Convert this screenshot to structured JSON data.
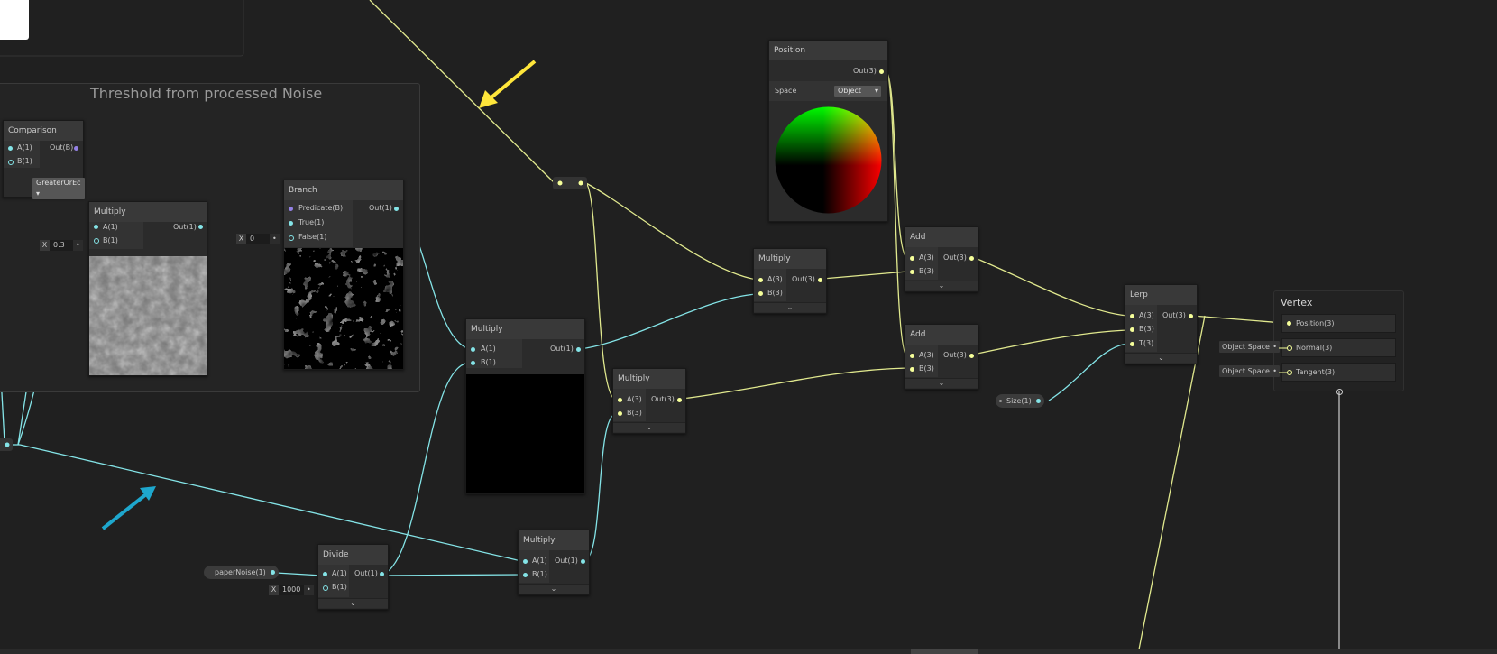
{
  "group": {
    "title": "Threshold  from processed Noise"
  },
  "colors": {
    "float": "#84e4e7",
    "vector3": "#f6ff9a",
    "boolean": "#9481e6",
    "background": "#202020",
    "arrow_yellow": "#ffe63b",
    "arrow_blue": "#1ea7cd"
  },
  "nodes": {
    "comparison": {
      "title": "Comparison",
      "in_a": "A(1)",
      "in_b": "B(1)",
      "out": "Out(B)",
      "mode": "GreaterOrEc"
    },
    "multiply_left": {
      "title": "Multiply",
      "in_a": "A(1)",
      "in_b": "B(1)",
      "out": "Out(1)"
    },
    "branch": {
      "title": "Branch",
      "in_pred": "Predicate(B)",
      "in_true": "True(1)",
      "in_false": "False(1)",
      "out": "Out(1)"
    },
    "multiply_mid": {
      "title": "Multiply",
      "in_a": "A(1)",
      "in_b": "B(1)",
      "out": "Out(1)"
    },
    "divide": {
      "title": "Divide",
      "in_a": "A(1)",
      "in_b": "B(1)",
      "out": "Out(1)"
    },
    "multiply_bottom": {
      "title": "Multiply",
      "in_a": "A(1)",
      "in_b": "B(1)",
      "out": "Out(1)"
    },
    "multiply_v3a": {
      "title": "Multiply",
      "in_a": "A(3)",
      "in_b": "B(3)",
      "out": "Out(3)"
    },
    "multiply_v3b": {
      "title": "Multiply",
      "in_a": "A(3)",
      "in_b": "B(3)",
      "out": "Out(3)"
    },
    "position": {
      "title": "Position",
      "out": "Out(3)",
      "space_label": "Space",
      "space_value": "Object"
    },
    "add_top": {
      "title": "Add",
      "in_a": "A(3)",
      "in_b": "B(3)",
      "out": "Out(3)"
    },
    "add_bottom": {
      "title": "Add",
      "in_a": "A(3)",
      "in_b": "B(3)",
      "out": "Out(3)"
    },
    "lerp": {
      "title": "Lerp",
      "in_a": "A(3)",
      "in_b": "B(3)",
      "in_t": "T(3)",
      "out": "Out(3)"
    }
  },
  "fields": {
    "mult_b": {
      "label": "X",
      "value": "0.3"
    },
    "branch_false": {
      "label": "X",
      "value": "0"
    },
    "divide_b": {
      "label": "X",
      "value": "1000"
    }
  },
  "properties": {
    "paper_noise": "paperNoise(1)",
    "size": "Size(1)"
  },
  "vertex": {
    "title": "Vertex",
    "position": "Position(3)",
    "normal": "Normal(3)",
    "tangent": "Tangent(3)",
    "normal_space": "Object Space",
    "tangent_space": "Object Space"
  },
  "icons": [
    "chevron-down-icon",
    "dropdown-arrow-icon",
    "arrow-annotation-icon"
  ]
}
